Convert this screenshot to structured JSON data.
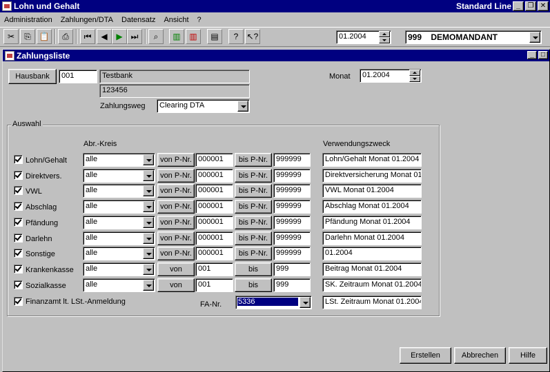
{
  "app": {
    "title": "Lohn und Gehalt",
    "edition": "Standard Line"
  },
  "menu": [
    "Administration",
    "Zahlungen/DTA",
    "Datensatz",
    "Ansicht",
    "?"
  ],
  "toolbar": {
    "period": "01.2004",
    "mandant": "999    DEMOMANDANT"
  },
  "child_window": {
    "title": "Zahlungsliste"
  },
  "header": {
    "hausbank_button": "Hausbank",
    "hausbank_nr": "001",
    "bank_name": "Testbank",
    "bank_code": "123456",
    "monat_label": "Monat",
    "monat_value": "01.2004",
    "zahlungsweg_label": "Zahlungsweg",
    "zahlungsweg_value": "Clearing DTA"
  },
  "auswahl": {
    "group_title": "Auswahl",
    "col_abr_kreis": "Abr.-Kreis",
    "col_verwendungszweck": "Verwendungszweck",
    "rows": [
      {
        "label": "Lohn/Gehalt",
        "kreis": "alle",
        "von_btn": "von P-Nr.",
        "von": "000001",
        "bis_btn": "bis P-Nr.",
        "bis": "999999",
        "zweck": "Lohn/Gehalt Monat 01.2004"
      },
      {
        "label": "Direktvers.",
        "kreis": "alle",
        "von_btn": "von P-Nr.",
        "von": "000001",
        "bis_btn": "bis P-Nr.",
        "bis": "999999",
        "zweck": "Direktversicherung Monat 01"
      },
      {
        "label": "VWL",
        "kreis": "alle",
        "von_btn": "von P-Nr.",
        "von": "000001",
        "bis_btn": "bis P-Nr.",
        "bis": "999999",
        "zweck": "VWL Monat 01.2004"
      },
      {
        "label": "Abschlag",
        "kreis": "alle",
        "von_btn": "von P-Nr.",
        "von": "000001",
        "bis_btn": "bis P-Nr.",
        "bis": "999999",
        "zweck": "Abschlag Monat 01.2004"
      },
      {
        "label": "Pfändung",
        "kreis": "alle",
        "von_btn": "von P-Nr.",
        "von": "000001",
        "bis_btn": "bis P-Nr.",
        "bis": "999999",
        "zweck": "Pfändung Monat 01.2004"
      },
      {
        "label": "Darlehn",
        "kreis": "alle",
        "von_btn": "von P-Nr.",
        "von": "000001",
        "bis_btn": "bis P-Nr.",
        "bis": "999999",
        "zweck": "Darlehn Monat 01.2004"
      },
      {
        "label": "Sonstige",
        "kreis": "alle",
        "von_btn": "von P-Nr.",
        "von": "000001",
        "bis_btn": "bis P-Nr.",
        "bis": "999999",
        "zweck": "01.2004"
      },
      {
        "label": "Krankenkasse",
        "kreis": "alle",
        "von_btn": "von",
        "von": "001",
        "bis_btn": "bis",
        "bis": "999",
        "zweck": "Beitrag Monat 01.2004"
      },
      {
        "label": "Sozialkasse",
        "kreis": "alle",
        "von_btn": "von",
        "von": "001",
        "bis_btn": "bis",
        "bis": "999",
        "zweck": "SK. Zeitraum Monat 01.2004"
      }
    ],
    "finanzamt_label": "Finanzamt lt. LSt.-Anmeldung",
    "fa_nr_label": "FA-Nr.",
    "fa_nr_value": "5336",
    "finanzamt_zweck": "LSt. Zeitraum Monat 01.2004"
  },
  "buttons": {
    "erstellen": "Erstellen",
    "abbrechen": "Abbrechen",
    "hilfe": "Hilfe"
  },
  "colors": {
    "titlebar": "#000080",
    "face": "#c0c0c0",
    "selection": "#000080"
  }
}
